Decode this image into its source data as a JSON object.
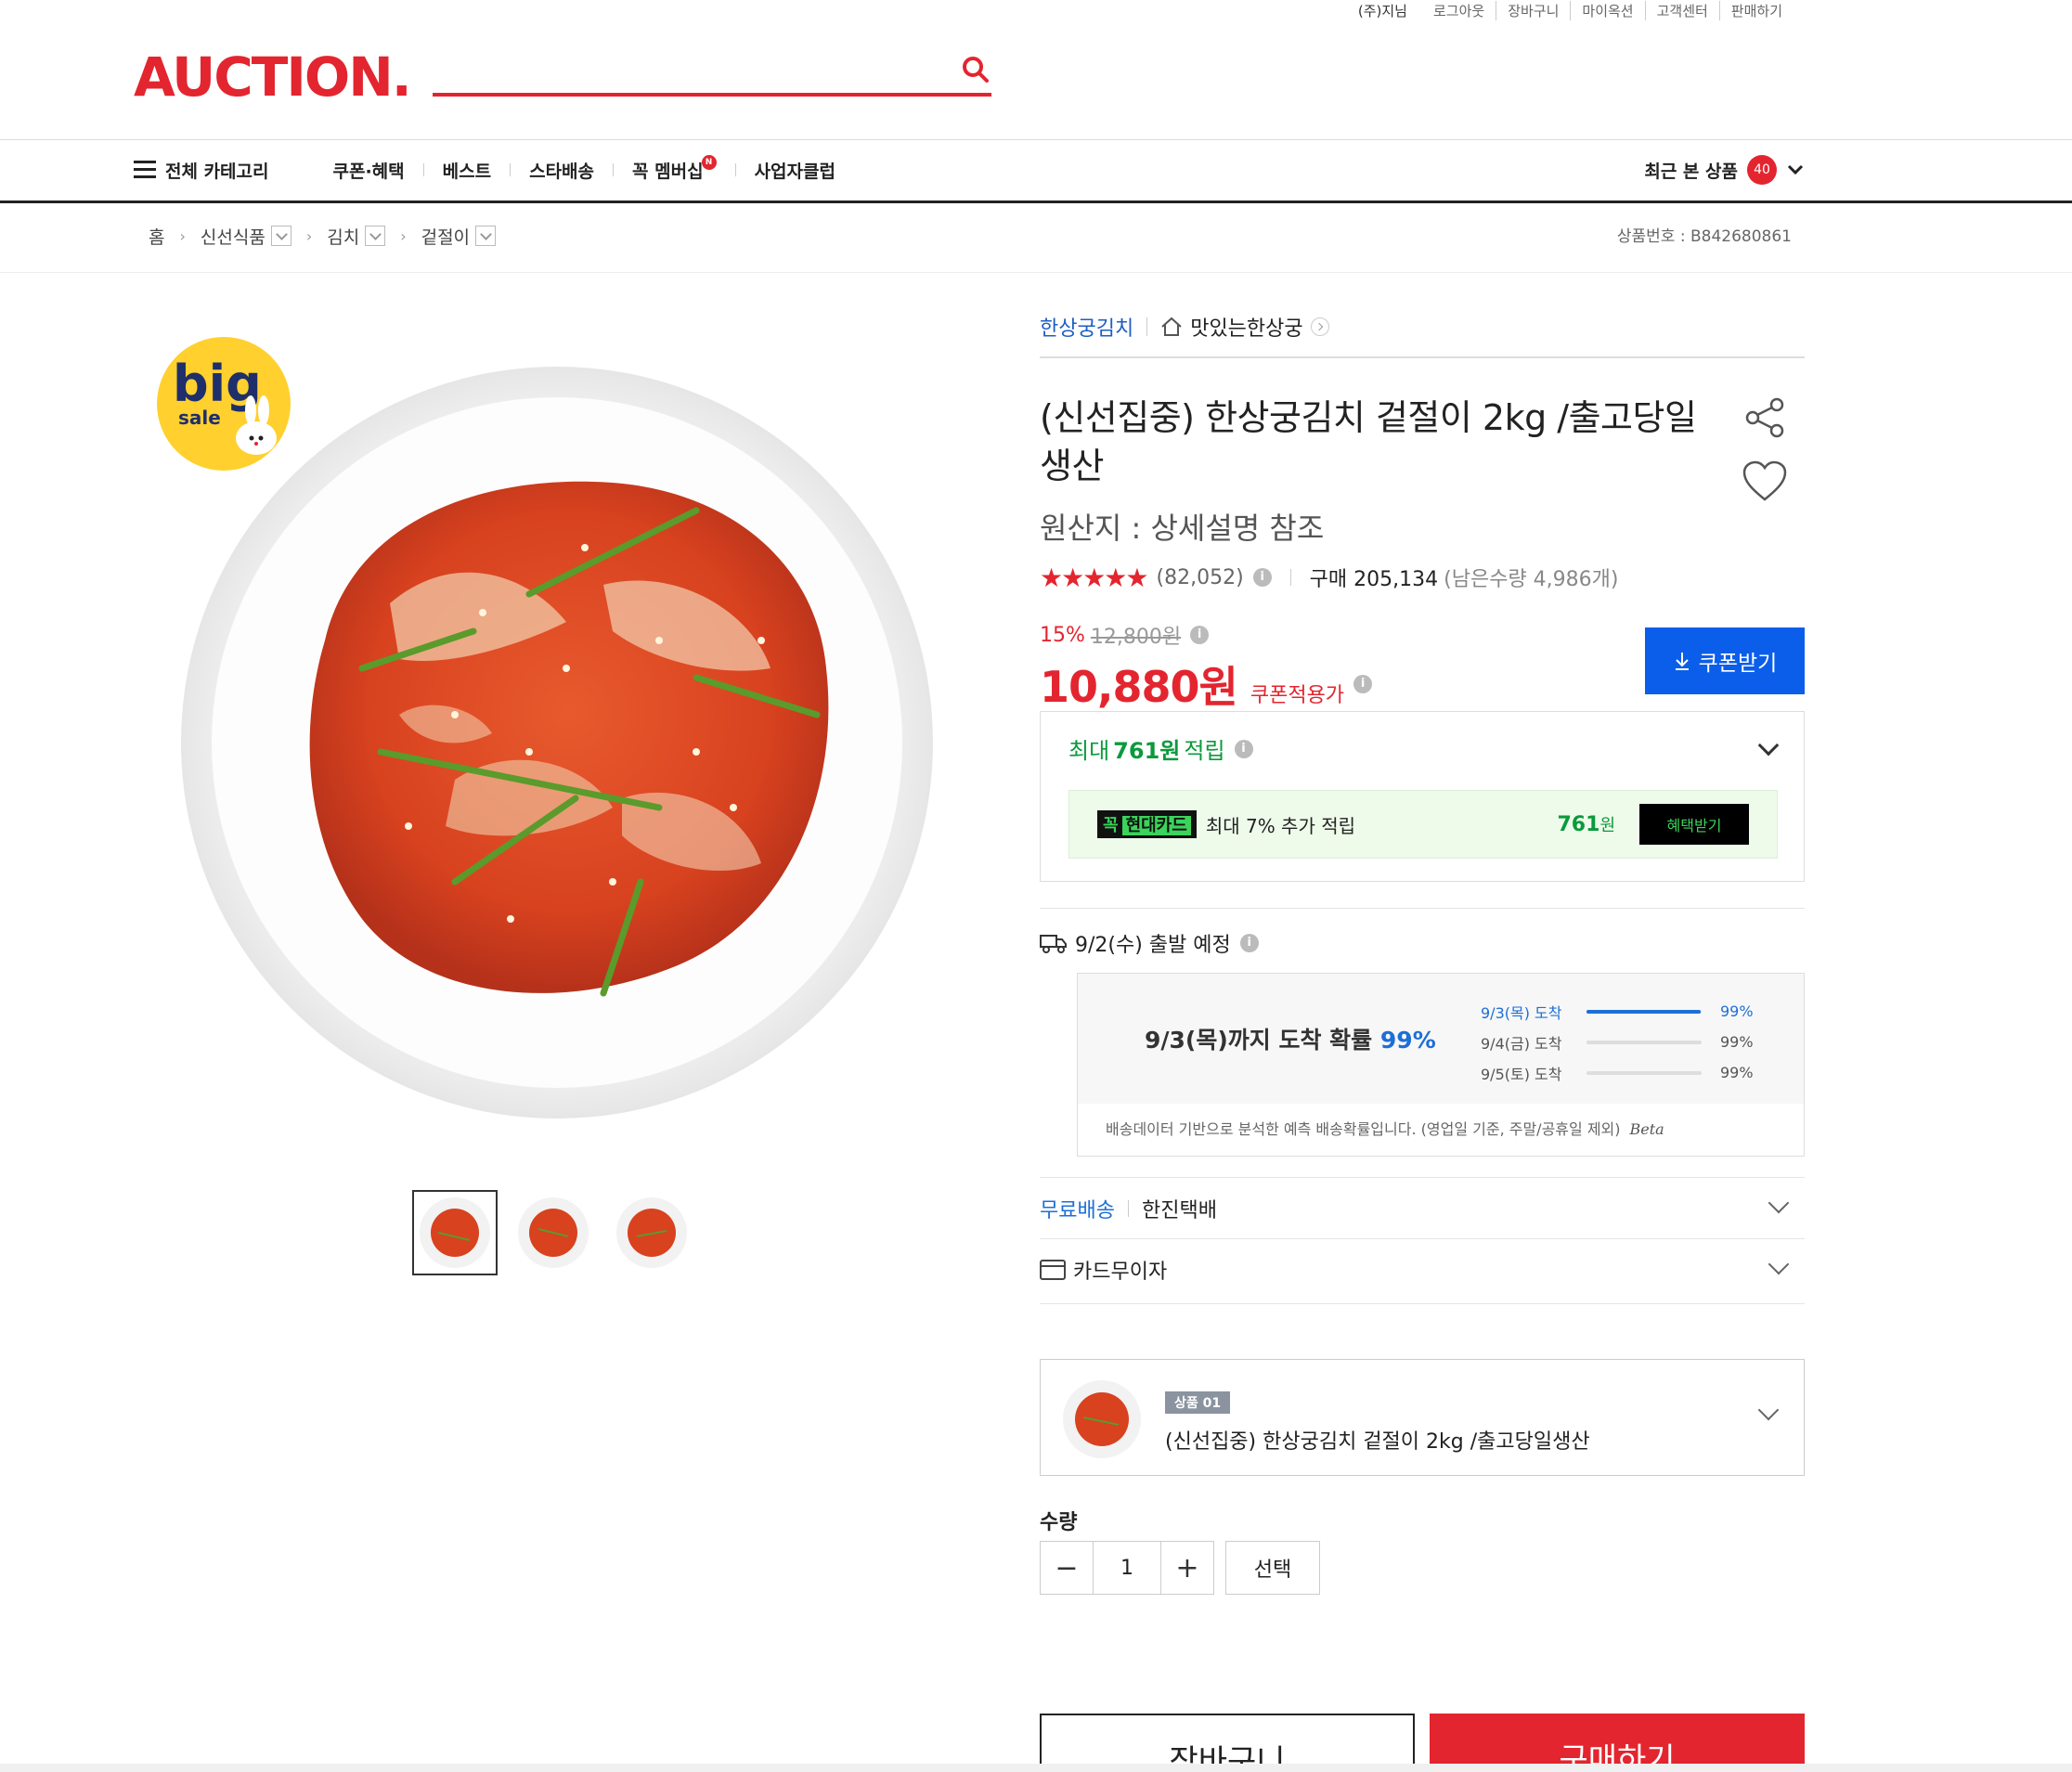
{
  "util_links": [
    "(주)지님",
    "로그아웃",
    "장바구니",
    "마이옥션",
    "고객센터",
    "판매하기"
  ],
  "logo": "AUCTION.",
  "search": {
    "placeholder": ""
  },
  "gnb": {
    "all_category": "전체 카테고리",
    "items": [
      "쿠폰·혜택",
      "베스트",
      "스타배송",
      "꼭 멤버십",
      "사업자클럽"
    ],
    "membership_badge": "N",
    "recent_label": "최근 본 상품",
    "recent_count": "40"
  },
  "breadcrumb": [
    "홈",
    "신선식품",
    "김치",
    "겉절이"
  ],
  "product_no": "상품번호 : B842680861",
  "brand": "한상궁김치",
  "store": "맛있는한상궁",
  "title": "(신선집중) 한상궁김치 겉절이 2kg /출고당일생산",
  "origin": "원산지 : 상세설명 참조",
  "rating": {
    "stars": 4.5,
    "stars_text": "★★★★★",
    "reviews": "(82,052)",
    "purchases": "구매 205,134",
    "remaining": "(남은수량 4,986개)"
  },
  "price": {
    "discount_pct": "15%",
    "original": "12,800원",
    "sale": "10,880원",
    "sale_label": "쿠폰적용가",
    "coupon_button": "쿠폰받기"
  },
  "points": {
    "prefix": "최대",
    "amount": "761원",
    "suffix": "적립",
    "card_logo_prefix": "꼭",
    "card_logo_name": "현대카드",
    "card_text": "최대 7% 추가 적립",
    "card_amount": "761",
    "card_amount_unit": "원",
    "card_button": "혜택받기"
  },
  "delivery": {
    "departure": "9/2(수) 출발 예정",
    "prob_text": "9/3(목)까지 도착 확률",
    "prob_value": "99%",
    "rows": [
      {
        "day": "9/3(목) 도착",
        "pct": "99%",
        "fill": 0.99
      },
      {
        "day": "9/4(금) 도착",
        "pct": "99%",
        "fill": 0.0
      },
      {
        "day": "9/5(토) 도착",
        "pct": "99%",
        "fill": 0.0
      }
    ],
    "note": "배송데이터 기반으로 분석한 예측 배송확률입니다. (영업일 기준, 주말/공휴일 제외)",
    "beta": "Beta"
  },
  "shipping": {
    "free": "무료배송",
    "carrier": "한진택배"
  },
  "card_installment": "카드무이자",
  "option": {
    "tag": "상품 01",
    "name": "(신선집중) 한상궁김치 겉절이 2kg /출고당일생산"
  },
  "quantity": {
    "label": "수량",
    "value": "1",
    "minus": "−",
    "plus": "+",
    "select": "선택"
  },
  "actions": {
    "cart": "장바구니",
    "buy": "구매하기"
  },
  "badge": {
    "line1": "big",
    "line2": "sale"
  },
  "colors": {
    "brand_red": "#e3252f",
    "blue": "#0b5eea",
    "green": "#0a9a3c"
  }
}
